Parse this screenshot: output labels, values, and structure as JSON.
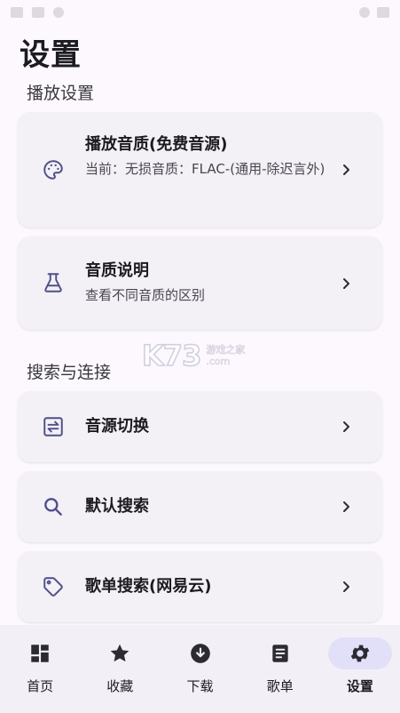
{
  "page": {
    "title": "设置"
  },
  "sections": [
    {
      "title": "播放设置",
      "items": [
        {
          "title": "播放音质(免费音源)",
          "subtitle": "当前：无损音质：FLAC-(通用-除迟言外)",
          "icon": "palette-icon"
        },
        {
          "title": "音质说明",
          "subtitle": "查看不同音质的区别",
          "icon": "flask-icon"
        }
      ]
    },
    {
      "title": "搜索与连接",
      "items": [
        {
          "title": "音源切换",
          "icon": "swap-icon"
        },
        {
          "title": "默认搜索",
          "icon": "search-icon"
        },
        {
          "title": "歌单搜索(网易云)",
          "icon": "tag-icon"
        }
      ]
    }
  ],
  "watermark": {
    "big": "K73",
    "line1": "游戏之家",
    "line2": ".com"
  },
  "nav": {
    "items": [
      {
        "label": "首页",
        "icon": "dashboard-icon",
        "active": false
      },
      {
        "label": "收藏",
        "icon": "star-icon",
        "active": false
      },
      {
        "label": "下载",
        "icon": "download-icon",
        "active": false
      },
      {
        "label": "歌单",
        "icon": "list-icon",
        "active": false
      },
      {
        "label": "设置",
        "icon": "gear-icon",
        "active": true
      }
    ]
  },
  "colors": {
    "accent": "#4f4f8a",
    "active_pill": "#e2e0f9",
    "card": "#f3f0f6"
  }
}
